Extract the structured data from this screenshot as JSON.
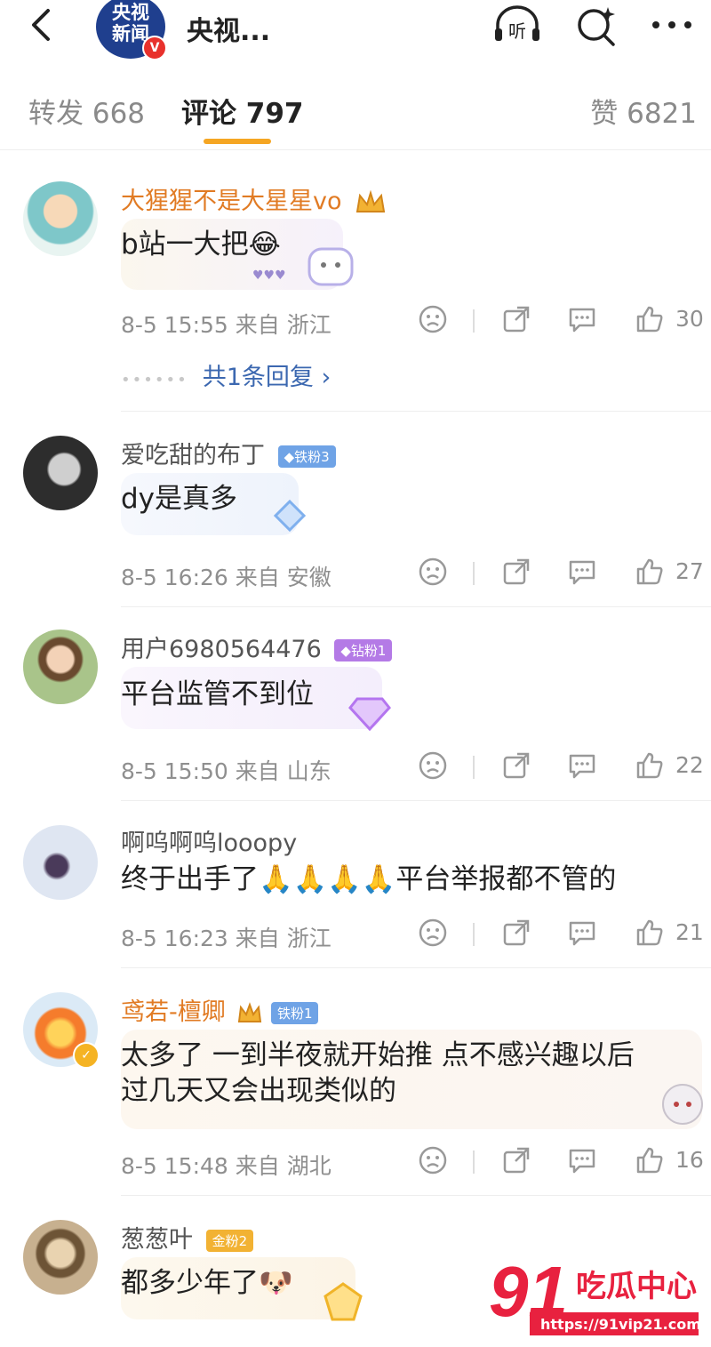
{
  "header": {
    "account_name": "央视...",
    "logo_line1": "央视",
    "logo_line2": "新闻",
    "verified_mark": "V",
    "listen_label": "听"
  },
  "tabs": [
    {
      "label": "转发 668"
    },
    {
      "label": "评论 797"
    },
    {
      "label": "赞 6821"
    }
  ],
  "colors": {
    "accent": "#f5a623",
    "vip_name": "#e17b24",
    "link": "#3c68b0"
  },
  "comments": [
    {
      "user": "大猩猩不是大星星vo",
      "badge": "",
      "text": "b站一大把😂",
      "time": "8-5 15:55 来自 浙江",
      "likes": "30",
      "replies": "共1条回复 ›"
    },
    {
      "user": "爱吃甜的布丁",
      "badge": "◆铁粉3",
      "text": "dy是真多",
      "time": "8-5 16:26 来自 安徽",
      "likes": "27"
    },
    {
      "user": "用户6980564476",
      "badge": "◆钻粉1",
      "text": "平台监管不到位",
      "time": "8-5 15:50 来自 山东",
      "likes": "22"
    },
    {
      "user": "啊呜啊呜looopy",
      "badge": "",
      "text": "终于出手了🙏🙏🙏🙏平台举报都不管的",
      "time": "8-5 16:23 来自 浙江",
      "likes": "21"
    },
    {
      "user": "鸢若-檀卿",
      "badge": "铁粉1",
      "text_line1": "太多了 一到半夜就开始推 点不感兴趣以后",
      "text_line2": "过几天又会出现类似的",
      "time": "8-5 15:48 来自 湖北",
      "likes": "16"
    },
    {
      "user": "葱葱叶",
      "badge": "金粉2",
      "text": "都多少年了🐶"
    }
  ],
  "watermark": {
    "big": "91",
    "small": "吃瓜中心",
    "url": "https://91vip21.com"
  }
}
